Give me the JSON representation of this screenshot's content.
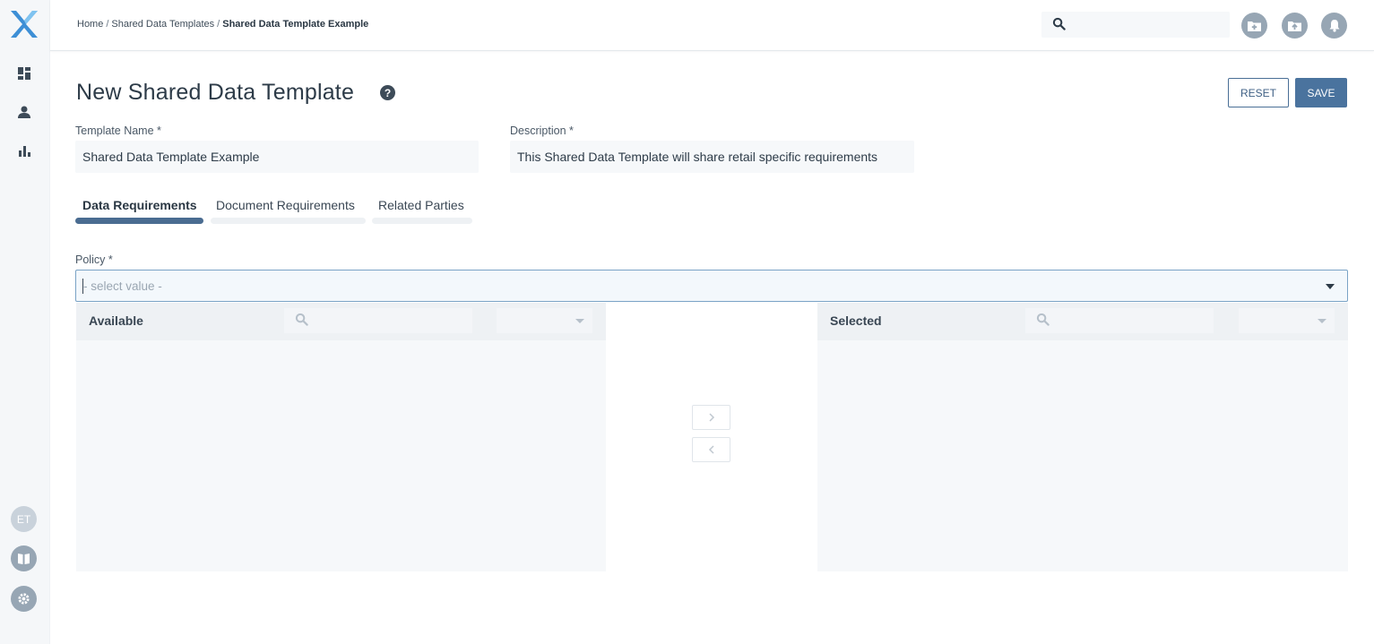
{
  "colors": {
    "accent": "#4a739e",
    "sidebar_bg": "#f5f7f9",
    "logo_blue": "#3d8fd6"
  },
  "sidebar": {
    "logo": "x-logo-icon",
    "nav": [
      {
        "icon": "dashboard-icon"
      },
      {
        "icon": "user-icon"
      },
      {
        "icon": "bar-chart-icon"
      }
    ],
    "avatar_initials": "ET",
    "bottom": [
      {
        "icon": "book-icon"
      },
      {
        "icon": "gear-icon"
      }
    ]
  },
  "header": {
    "breadcrumb": [
      "Home",
      "Shared Data Templates",
      "Shared Data Template Example"
    ],
    "search_placeholder": "",
    "icons": [
      "add-folder-icon",
      "upload-folder-icon",
      "bell-icon"
    ]
  },
  "page": {
    "title": "New Shared Data Template",
    "help": "?",
    "reset_label": "RESET",
    "save_label": "SAVE"
  },
  "form": {
    "template_name_label": "Template Name *",
    "template_name_value": "Shared Data Template Example",
    "description_label": "Description *",
    "description_value": "This Shared Data Template will share retail specific requirements"
  },
  "tabs": [
    {
      "label": "Data Requirements",
      "active": true
    },
    {
      "label": "Document Requirements",
      "active": false
    },
    {
      "label": "Related Parties",
      "active": false
    }
  ],
  "policy": {
    "label": "Policy *",
    "placeholder": "- select value -"
  },
  "available": {
    "title": "Available",
    "search_placeholder": ""
  },
  "selected": {
    "title": "Selected",
    "search_placeholder": ""
  },
  "transfer": {
    "move_right": ">",
    "move_left": "<"
  }
}
